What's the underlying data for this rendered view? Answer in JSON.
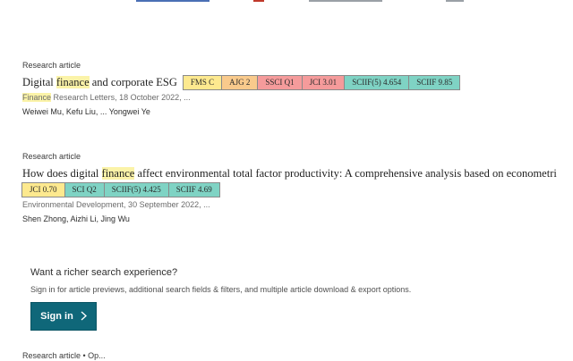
{
  "colors": {
    "highlight": "#fbf3a8",
    "badge_yellow": "#fde98f",
    "badge_orange": "#f9ca8c",
    "badge_red": "#f59b9b",
    "badge_teal": "#7fd3c4",
    "signin_bg": "#0f6779"
  },
  "results": [
    {
      "type": "Research article",
      "title_pre": "Digital ",
      "title_hl": "finance",
      "title_post": " and corporate ESG",
      "badges": [
        "FMS C",
        "AJG 2",
        "SSCI Q1",
        "JCI 3.01",
        "SCIIF(5) 4.654",
        "SCIIF 9.85"
      ],
      "journal_hl": "Finance",
      "journal_rest": " Research Letters, 18 October 2022, ...",
      "authors": "Weiwei Mu, Kefu Liu, ... Yongwei Ye"
    },
    {
      "type": "Research article",
      "title_pre": "How does digital ",
      "title_hl": "finance",
      "title_post": " affect environmental total factor productivity: A comprehensive analysis based on econometri",
      "badges": [
        "JCI 0.70",
        "SCI Q2",
        "SCIIF(5) 4.425",
        "SCIIF 4.69"
      ],
      "journal": "Environmental Development, 30 September 2022, ...",
      "authors": "Shen Zhong, Aizhi Li, Jing Wu"
    }
  ],
  "promo": {
    "title": "Want a richer search experience?",
    "description": "Sign in for article previews, additional search fields & filters, and multiple article download & export options.",
    "button_label": "Sign in",
    "button_icon": "chevron-right-icon"
  },
  "bottom_partial": "Research article • Op..."
}
